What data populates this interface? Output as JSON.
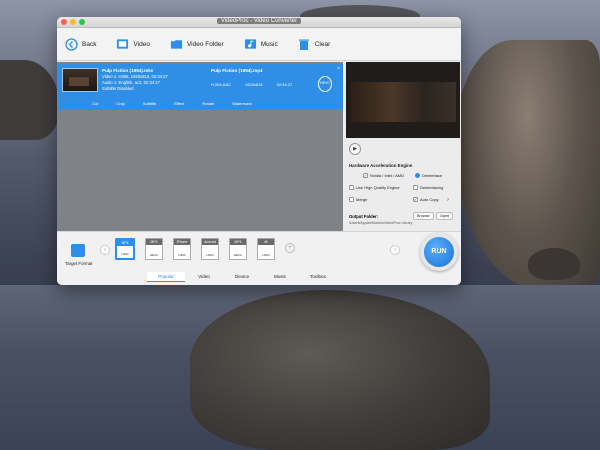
{
  "window": {
    "title": "VideoProc - Video Converter"
  },
  "toolbar": {
    "back": "Back",
    "video": "Video",
    "video_folder": "Video Folder",
    "music": "Music",
    "clear": "Clear"
  },
  "file": {
    "source_name": "Pulp Fiction (1994).mkv",
    "source_video": "Video 1: H265, 1920x816, 02:34:27",
    "source_audio": "Audio 1: English, ac3, 02:34:27",
    "source_subtitle": "Subtitle Disabled",
    "output_name": "Pulp Fiction (1994).mp4",
    "output_codec": "H.264,AAC",
    "output_resolution": "1920x816",
    "output_duration": "02:34:27",
    "codec_badge": "HEVC",
    "actions": [
      "Cut",
      "Crop",
      "Subtitle",
      "Effect",
      "Rotate",
      "Watermark"
    ]
  },
  "hardware": {
    "title": "Hardware Acceleration Engine",
    "nvidia": "Nvidia / Intel / AMD",
    "deinterlace": "Deinterlace",
    "high_quality": "Use High Quality Engine",
    "deinterlacing": "Deinterlacing",
    "merge": "Merge",
    "auto_copy": "Auto Copy",
    "browse": "Browse",
    "open": "Open",
    "output_folder_label": "Output Folder:",
    "output_folder_path": "/Users/Applet/Movies/VideoProc Library"
  },
  "target": {
    "label": "Target Format"
  },
  "formats": [
    {
      "tag": "MP4",
      "sub": "H264"
    },
    {
      "tag": "MP4",
      "sub": "HEVC"
    },
    {
      "tag": "iPhone",
      "sub": "H264"
    },
    {
      "tag": "Android",
      "sub": "H264"
    },
    {
      "tag": "MP4",
      "sub": "HEVC"
    },
    {
      "tag": "4K",
      "sub": "H264"
    }
  ],
  "tabs": [
    "Popular",
    "Video",
    "Device",
    "Music",
    "Toolbox"
  ],
  "run_label": "RUN",
  "colors": {
    "accent": "#2f8fe6"
  }
}
